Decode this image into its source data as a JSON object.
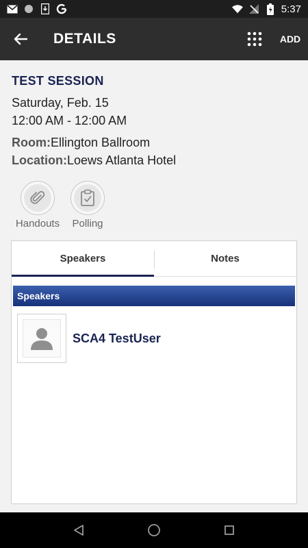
{
  "status_bar": {
    "time": "5:37"
  },
  "app_bar": {
    "title": "DETAILS",
    "add_label": "ADD"
  },
  "session": {
    "title": "TEST SESSION",
    "date": "Saturday, Feb. 15",
    "time": "12:00 AM - 12:00 AM",
    "room_label": "Room:",
    "room_value": "Ellington Ballroom",
    "location_label": "Location:",
    "location_value": "Loews Atlanta Hotel"
  },
  "actions": [
    {
      "label": "Handouts",
      "icon": "paperclip-icon"
    },
    {
      "label": "Polling",
      "icon": "clipboard-check-icon"
    }
  ],
  "tabs": [
    {
      "label": "Speakers",
      "active": true
    },
    {
      "label": "Notes",
      "active": false
    }
  ],
  "speakers_section": {
    "header": "Speakers",
    "items": [
      {
        "name": "SCA4 TestUser"
      }
    ]
  },
  "colors": {
    "accent": "#1a2351",
    "app_bar": "#2e2e2e",
    "header_blue": "#16327a"
  }
}
